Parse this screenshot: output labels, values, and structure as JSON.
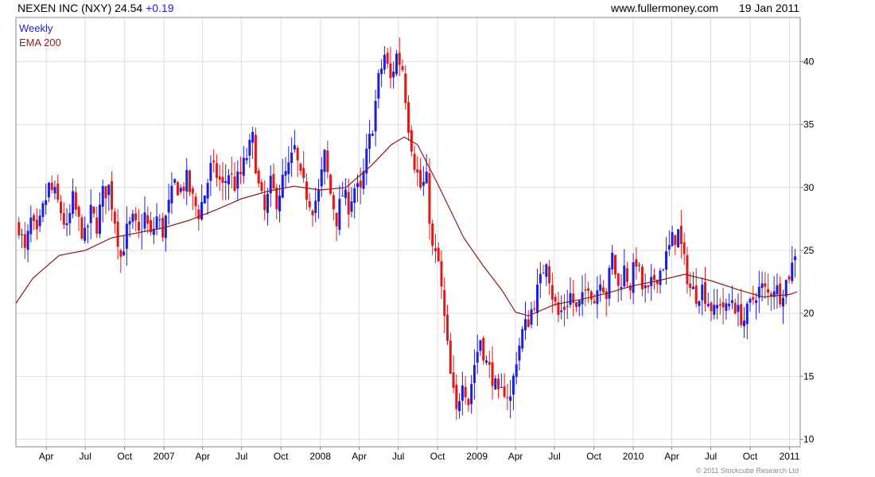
{
  "header": {
    "symbol": "NEXEN INC (NXY)",
    "price": "24.54",
    "change": "+0.19",
    "site": "www.fullermoney.com",
    "date": "19 Jan 2011"
  },
  "copyright": "© 2011 Stockcube Research Ltd",
  "colors": {
    "up": "#1d1ddc",
    "down": "#e01818",
    "ema": "#8b1a1a",
    "grid": "#dddddd",
    "frame": "#888888"
  },
  "chart_data": {
    "type": "candlestick",
    "timeframe": "Weekly",
    "legend": [
      "Weekly",
      "EMA 200"
    ],
    "legend_position": "top-left",
    "ylim": [
      9.4,
      43.5
    ],
    "yticks": [
      10,
      15,
      20,
      25,
      30,
      35,
      40
    ],
    "xlim": [
      "2006-01-20",
      "2011-01-26"
    ],
    "xticks": [
      {
        "date": "2006-04-01",
        "label": "Apr"
      },
      {
        "date": "2006-07-01",
        "label": "Jul"
      },
      {
        "date": "2006-10-01",
        "label": "Oct"
      },
      {
        "date": "2007-01-01",
        "label": "2007"
      },
      {
        "date": "2007-04-01",
        "label": "Apr"
      },
      {
        "date": "2007-07-01",
        "label": "Jul"
      },
      {
        "date": "2007-10-01",
        "label": "Oct"
      },
      {
        "date": "2008-01-01",
        "label": "2008"
      },
      {
        "date": "2008-04-01",
        "label": "Apr"
      },
      {
        "date": "2008-07-01",
        "label": "Jul"
      },
      {
        "date": "2008-10-01",
        "label": "Oct"
      },
      {
        "date": "2009-01-01",
        "label": "2009"
      },
      {
        "date": "2009-04-01",
        "label": "Apr"
      },
      {
        "date": "2009-07-01",
        "label": "Jul"
      },
      {
        "date": "2009-10-01",
        "label": "Oct"
      },
      {
        "date": "2010-01-01",
        "label": "2010"
      },
      {
        "date": "2010-04-01",
        "label": "Apr"
      },
      {
        "date": "2010-07-01",
        "label": "Jul"
      },
      {
        "date": "2010-10-01",
        "label": "Oct"
      },
      {
        "date": "2011-01-01",
        "label": "2011"
      }
    ],
    "grid": true,
    "ema_200": [
      [
        "2006-01-20",
        20.8
      ],
      [
        "2006-03-01",
        22.8
      ],
      [
        "2006-05-01",
        24.6
      ],
      [
        "2006-07-01",
        25.0
      ],
      [
        "2006-09-01",
        26.0
      ],
      [
        "2006-11-01",
        26.4
      ],
      [
        "2007-01-01",
        26.8
      ],
      [
        "2007-03-01",
        27.4
      ],
      [
        "2007-05-01",
        28.2
      ],
      [
        "2007-07-01",
        29.1
      ],
      [
        "2007-09-01",
        29.7
      ],
      [
        "2007-11-01",
        30.1
      ],
      [
        "2008-01-01",
        29.8
      ],
      [
        "2008-03-01",
        30.0
      ],
      [
        "2008-05-01",
        31.8
      ],
      [
        "2008-06-15",
        33.4
      ],
      [
        "2008-07-15",
        34.0
      ],
      [
        "2008-08-15",
        33.4
      ],
      [
        "2008-10-01",
        30.3
      ],
      [
        "2008-12-01",
        26.0
      ],
      [
        "2009-01-15",
        23.8
      ],
      [
        "2009-03-01",
        21.8
      ],
      [
        "2009-04-01",
        20.1
      ],
      [
        "2009-05-01",
        19.8
      ],
      [
        "2009-07-01",
        20.7
      ],
      [
        "2009-09-01",
        21.1
      ],
      [
        "2009-11-01",
        21.6
      ],
      [
        "2010-01-01",
        22.2
      ],
      [
        "2010-03-01",
        22.6
      ],
      [
        "2010-05-01",
        23.1
      ],
      [
        "2010-07-01",
        22.6
      ],
      [
        "2010-09-01",
        21.9
      ],
      [
        "2010-11-01",
        21.3
      ],
      [
        "2011-01-01",
        21.5
      ],
      [
        "2011-01-19",
        21.7
      ]
    ],
    "weekly_close_path": [
      [
        "2006-01-27",
        27.0
      ],
      [
        "2006-02-10",
        24.8
      ],
      [
        "2006-02-24",
        27.3
      ],
      [
        "2006-03-10",
        26.0
      ],
      [
        "2006-03-24",
        28.2
      ],
      [
        "2006-04-07",
        30.0
      ],
      [
        "2006-04-21",
        29.4
      ],
      [
        "2006-05-05",
        28.1
      ],
      [
        "2006-05-19",
        26.5
      ],
      [
        "2006-06-02",
        29.0
      ],
      [
        "2006-06-16",
        27.2
      ],
      [
        "2006-06-30",
        26.0
      ],
      [
        "2006-07-14",
        28.0
      ],
      [
        "2006-07-28",
        27.0
      ],
      [
        "2006-08-11",
        29.5
      ],
      [
        "2006-08-25",
        30.0
      ],
      [
        "2006-09-08",
        27.5
      ],
      [
        "2006-09-22",
        24.5
      ],
      [
        "2006-10-06",
        26.5
      ],
      [
        "2006-10-20",
        27.3
      ],
      [
        "2006-11-03",
        26.2
      ],
      [
        "2006-11-17",
        27.8
      ],
      [
        "2006-12-01",
        26.0
      ],
      [
        "2006-12-15",
        27.6
      ],
      [
        "2006-12-29",
        26.5
      ],
      [
        "2007-01-12",
        28.5
      ],
      [
        "2007-01-26",
        30.3
      ],
      [
        "2007-02-09",
        29.8
      ],
      [
        "2007-02-23",
        30.6
      ],
      [
        "2007-03-09",
        29.0
      ],
      [
        "2007-03-23",
        28.0
      ],
      [
        "2007-04-06",
        29.5
      ],
      [
        "2007-04-20",
        31.5
      ],
      [
        "2007-05-04",
        31.0
      ],
      [
        "2007-05-18",
        30.0
      ],
      [
        "2007-06-01",
        31.2
      ],
      [
        "2007-06-15",
        30.2
      ],
      [
        "2007-06-29",
        31.0
      ],
      [
        "2007-07-13",
        32.5
      ],
      [
        "2007-07-27",
        33.8
      ],
      [
        "2007-08-10",
        30.0
      ],
      [
        "2007-08-24",
        28.0
      ],
      [
        "2007-09-07",
        30.2
      ],
      [
        "2007-09-21",
        29.0
      ],
      [
        "2007-10-05",
        30.5
      ],
      [
        "2007-10-19",
        31.5
      ],
      [
        "2007-11-02",
        33.0
      ],
      [
        "2007-11-16",
        30.6
      ],
      [
        "2007-11-30",
        29.5
      ],
      [
        "2007-12-14",
        28.5
      ],
      [
        "2007-12-28",
        29.5
      ],
      [
        "2008-01-11",
        32.5
      ],
      [
        "2008-01-25",
        29.5
      ],
      [
        "2008-02-08",
        27.5
      ],
      [
        "2008-02-22",
        29.5
      ],
      [
        "2008-03-07",
        28.6
      ],
      [
        "2008-03-21",
        30.0
      ],
      [
        "2008-04-04",
        29.5
      ],
      [
        "2008-04-18",
        32.5
      ],
      [
        "2008-05-02",
        35.0
      ],
      [
        "2008-05-16",
        38.5
      ],
      [
        "2008-05-30",
        40.5
      ],
      [
        "2008-06-13",
        38.5
      ],
      [
        "2008-06-27",
        40.5
      ],
      [
        "2008-07-11",
        39.5
      ],
      [
        "2008-07-25",
        35.0
      ],
      [
        "2008-08-08",
        32.0
      ],
      [
        "2008-08-22",
        30.0
      ],
      [
        "2008-09-05",
        30.5
      ],
      [
        "2008-09-19",
        25.0
      ],
      [
        "2008-10-03",
        24.0
      ],
      [
        "2008-10-17",
        19.5
      ],
      [
        "2008-10-31",
        15.0
      ],
      [
        "2008-11-14",
        12.0
      ],
      [
        "2008-11-28",
        15.0
      ],
      [
        "2008-12-12",
        13.0
      ],
      [
        "2008-12-26",
        16.0
      ],
      [
        "2009-01-09",
        18.0
      ],
      [
        "2009-01-23",
        16.0
      ],
      [
        "2009-02-06",
        15.0
      ],
      [
        "2009-02-20",
        13.2
      ],
      [
        "2009-03-06",
        14.0
      ],
      [
        "2009-03-20",
        13.2
      ],
      [
        "2009-04-03",
        16.5
      ],
      [
        "2009-04-17",
        18.5
      ],
      [
        "2009-05-01",
        19.5
      ],
      [
        "2009-05-15",
        21.0
      ],
      [
        "2009-05-29",
        22.5
      ],
      [
        "2009-06-12",
        24.5
      ],
      [
        "2009-06-26",
        21.5
      ],
      [
        "2009-07-10",
        19.8
      ],
      [
        "2009-07-24",
        20.5
      ],
      [
        "2009-08-07",
        21.5
      ],
      [
        "2009-08-21",
        20.2
      ],
      [
        "2009-09-04",
        21.0
      ],
      [
        "2009-09-18",
        22.5
      ],
      [
        "2009-10-02",
        21.0
      ],
      [
        "2009-10-16",
        23.0
      ],
      [
        "2009-10-30",
        21.5
      ],
      [
        "2009-11-13",
        24.5
      ],
      [
        "2009-11-27",
        22.0
      ],
      [
        "2009-12-11",
        23.5
      ],
      [
        "2009-12-25",
        22.3
      ],
      [
        "2010-01-08",
        24.3
      ],
      [
        "2010-01-22",
        22.0
      ],
      [
        "2010-02-05",
        21.5
      ],
      [
        "2010-02-19",
        22.8
      ],
      [
        "2010-03-05",
        23.4
      ],
      [
        "2010-03-19",
        24.5
      ],
      [
        "2010-04-02",
        25.8
      ],
      [
        "2010-04-16",
        26.4
      ],
      [
        "2010-04-30",
        24.0
      ],
      [
        "2010-05-14",
        22.0
      ],
      [
        "2010-05-28",
        21.5
      ],
      [
        "2010-06-11",
        22.0
      ],
      [
        "2010-06-25",
        21.0
      ],
      [
        "2010-07-09",
        20.0
      ],
      [
        "2010-07-23",
        21.0
      ],
      [
        "2010-08-06",
        20.2
      ],
      [
        "2010-08-20",
        21.2
      ],
      [
        "2010-09-03",
        20.0
      ],
      [
        "2010-09-17",
        19.5
      ],
      [
        "2010-10-01",
        20.6
      ],
      [
        "2010-10-15",
        21.7
      ],
      [
        "2010-10-29",
        22.0
      ],
      [
        "2010-11-12",
        21.5
      ],
      [
        "2010-11-26",
        22.2
      ],
      [
        "2010-12-10",
        21.5
      ],
      [
        "2010-12-24",
        22.5
      ],
      [
        "2011-01-07",
        23.8
      ],
      [
        "2011-01-19",
        24.54
      ]
    ]
  }
}
